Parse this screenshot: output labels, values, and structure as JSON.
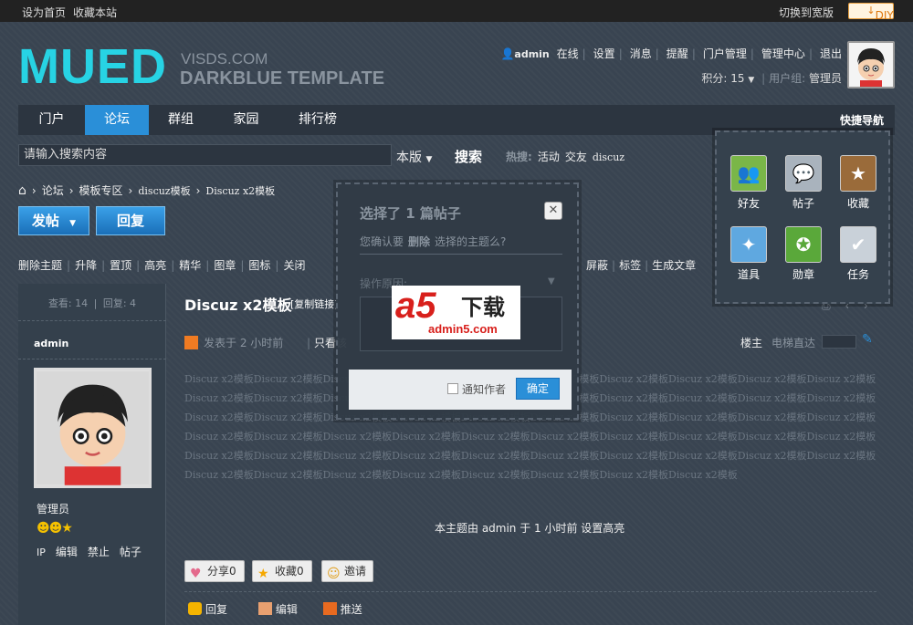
{
  "topbar": {
    "set_home": "设为首页",
    "bookmark": "收藏本站",
    "wide": "切换到宽版",
    "diy": "DIY"
  },
  "logo": {
    "main": "MUED",
    "sub1": "VISDS.COM",
    "sub2": "DARKBLUE TEMPLATE"
  },
  "user": {
    "name": "admin",
    "online": "在线",
    "links": [
      "设置",
      "消息",
      "提醒",
      "门户管理",
      "管理中心",
      "退出"
    ],
    "points_label": "积分: 15",
    "group_label": "用户组:",
    "group": "管理员"
  },
  "nav": {
    "items": [
      "门户",
      "论坛",
      "群组",
      "家园",
      "排行榜"
    ],
    "active": "论坛",
    "quick": "快捷导航"
  },
  "search": {
    "placeholder": "请输入搜索内容",
    "scope": "本版",
    "button": "搜索",
    "hot_label": "热搜:",
    "hot": [
      "活动",
      "交友",
      "discuz"
    ]
  },
  "breadcrumb": [
    "论坛",
    "模板专区",
    "discuz模板",
    "Discuz x2模板"
  ],
  "buttons": {
    "post": "发帖",
    "reply": "回复"
  },
  "modbar": [
    "删除主题",
    "升降",
    "置顶",
    "高亮",
    "精华",
    "图章",
    "图标",
    "关闭"
  ],
  "modbar_right": [
    "屏蔽",
    "标签",
    "生成文章"
  ],
  "sidebar": {
    "views": "查看: 14",
    "replies": "回复: 4",
    "author": "admin",
    "group": "管理员",
    "links": [
      "IP",
      "编辑",
      "禁止",
      "帖子"
    ]
  },
  "post": {
    "title": "Discuz x2模板",
    "copy_link": "[复制链接]",
    "meta": "发表于 2 小时前",
    "view_only": "只看该",
    "louzhu": "楼主",
    "elevator": "电梯直达",
    "body": "Discuz x2模板Discuz x2模板Discuz x2模板Discuz x2模板Discuz x2模板Discuz x2模板Discuz x2模板Discuz x2模板Discuz x2模板Discuz x2模板Discuz x2模板Discuz x2模板Discuz x2模板Discuz x2模板Discuz x2模板Discuz x2模板Discuz x2模板Discuz x2模板Discuz x2模板Discuz x2模板Discuz x2模板Discuz x2模板Discuz x2模板Discuz x2模板Discuz x2模板Discuz x2模板Discuz x2模板Discuz x2模板Discuz x2模板Discuz x2模板Discuz x2模板Discuz x2模板Discuz x2模板Discuz x2模板Discuz x2模板Discuz x2模板Discuz x2模板Discuz x2模板Discuz x2模板Discuz x2模板Discuz x2模板Discuz x2模板Discuz x2模板Discuz x2模板Discuz x2模板Discuz x2模板Discuz x2模板Discuz x2模板Discuz x2模板Discuz x2模板Discuz x2模板Discuz x2模板Discuz x2模板Discuz x2模板Discuz x2模板Discuz x2模板Discuz x2模板Discuz x2模板",
    "mod_note": "本主题由 admin 于 1 小时前 设置高亮",
    "share": "分享0",
    "fav": "收藏0",
    "invite": "邀请",
    "actions": [
      "回复",
      "编辑",
      "推送"
    ]
  },
  "quick_panel": [
    {
      "label": "好友",
      "icon": "friends-icon",
      "color": "#7ab648"
    },
    {
      "label": "帖子",
      "icon": "post-icon",
      "color": "#a9b3bd"
    },
    {
      "label": "收藏",
      "icon": "star-icon",
      "color": "#9a6b3a"
    },
    {
      "label": "道具",
      "icon": "wand-icon",
      "color": "#5fa8e0"
    },
    {
      "label": "勋章",
      "icon": "medal-icon",
      "color": "#5aa83a"
    },
    {
      "label": "任务",
      "icon": "task-icon",
      "color": "#c9d1d9"
    }
  ],
  "dialog": {
    "title": "选择了 1 篇帖子",
    "confirm_pre": "您确认要",
    "confirm_action": "删除",
    "confirm_post": "选择的主题么?",
    "reason_label": "操作原因:",
    "notify": "通知作者",
    "ok": "确定",
    "close": "✕"
  },
  "watermark": {
    "brand": "a5",
    "cn": "下载",
    "url": "admin5.com"
  }
}
